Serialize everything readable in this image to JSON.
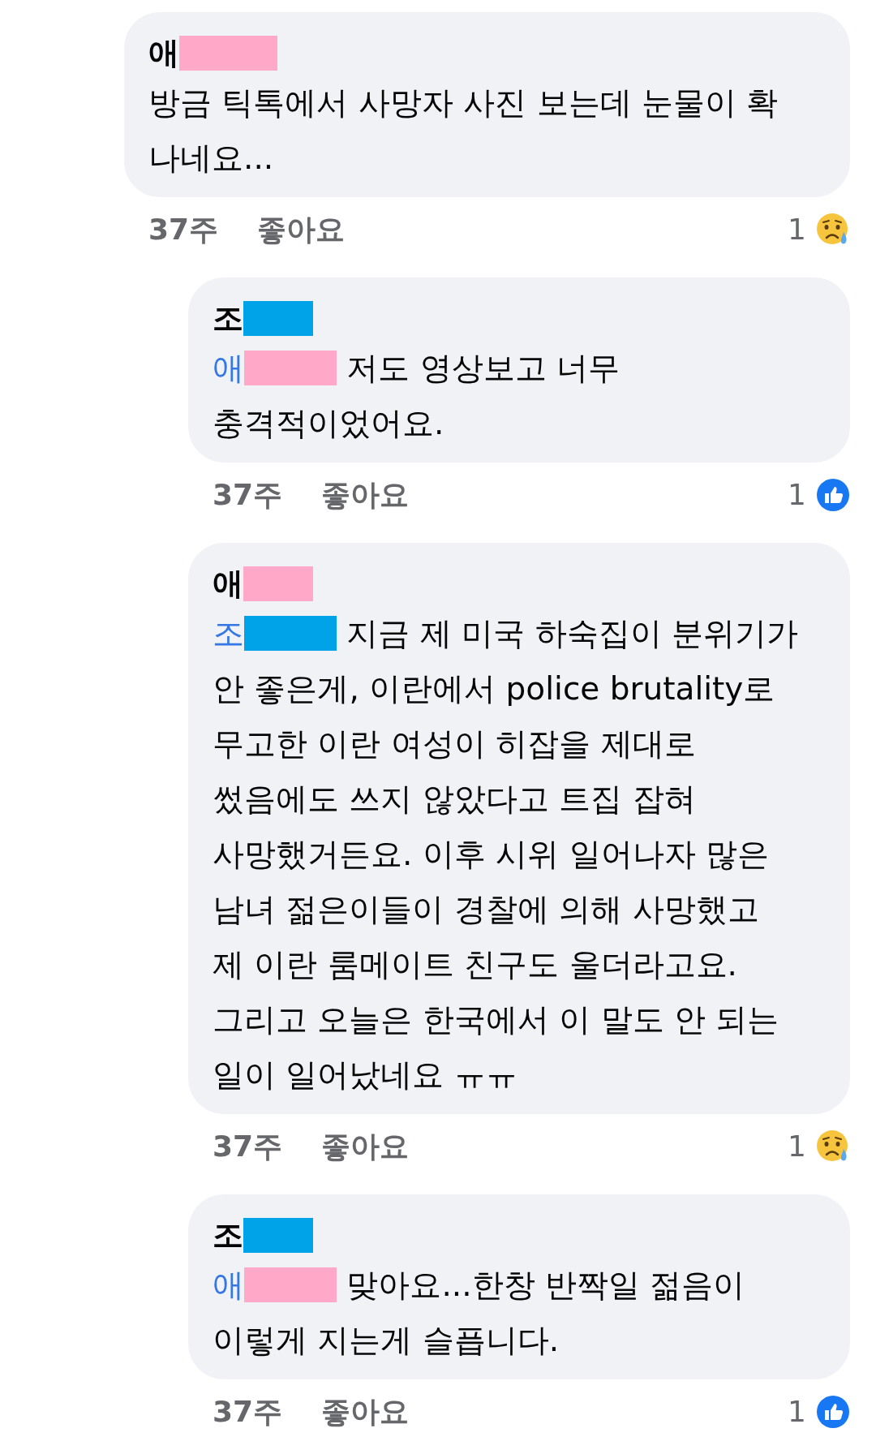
{
  "comments": [
    {
      "author": {
        "initial": "애",
        "color": "#ffa8c8"
      },
      "lines": [
        "방금 틱톡에서 사망자 사진 보는데 눈물이 확",
        "나네요..."
      ],
      "time": "37주",
      "like_label": "좋아요",
      "reaction": {
        "count": "1",
        "kind": "sad"
      },
      "replies": [
        {
          "author": {
            "initial": "조",
            "color": "#00a2e8"
          },
          "mention": {
            "initial": "애",
            "color": "#ffa8c8"
          },
          "lines": [
            "저도 영상보고 너무",
            "충격적이었어요."
          ],
          "time": "37주",
          "like_label": "좋아요",
          "reaction": {
            "count": "1",
            "kind": "like"
          }
        },
        {
          "author": {
            "initial": "애",
            "color": "#ffa8c8"
          },
          "mention": {
            "initial": "조",
            "color": "#00a2e8"
          },
          "lines": [
            "지금 제 미국 하숙집이 분위기가",
            "안 좋은게, 이란에서 police brutality로",
            "무고한 이란 여성이 히잡을 제대로",
            "썼음에도 쓰지 않았다고 트집 잡혀",
            "사망했거든요. 이후 시위 일어나자 많은",
            "남녀 젊은이들이 경찰에 의해 사망했고",
            "제 이란 룸메이트 친구도 울더라고요.",
            "그리고 오늘은 한국에서 이 말도 안 되는",
            "일이 일어났네요 ㅠㅠ"
          ],
          "time": "37주",
          "like_label": "좋아요",
          "reaction": {
            "count": "1",
            "kind": "sad"
          }
        },
        {
          "author": {
            "initial": "조",
            "color": "#00a2e8"
          },
          "mention": {
            "initial": "애",
            "color": "#ffa8c8"
          },
          "lines": [
            "맞아요...한창 반짝일 젊음이",
            "이렇게 지는게 슬픕니다."
          ],
          "time": "37주",
          "like_label": "좋아요",
          "reaction": {
            "count": "1",
            "kind": "like"
          }
        }
      ]
    }
  ]
}
